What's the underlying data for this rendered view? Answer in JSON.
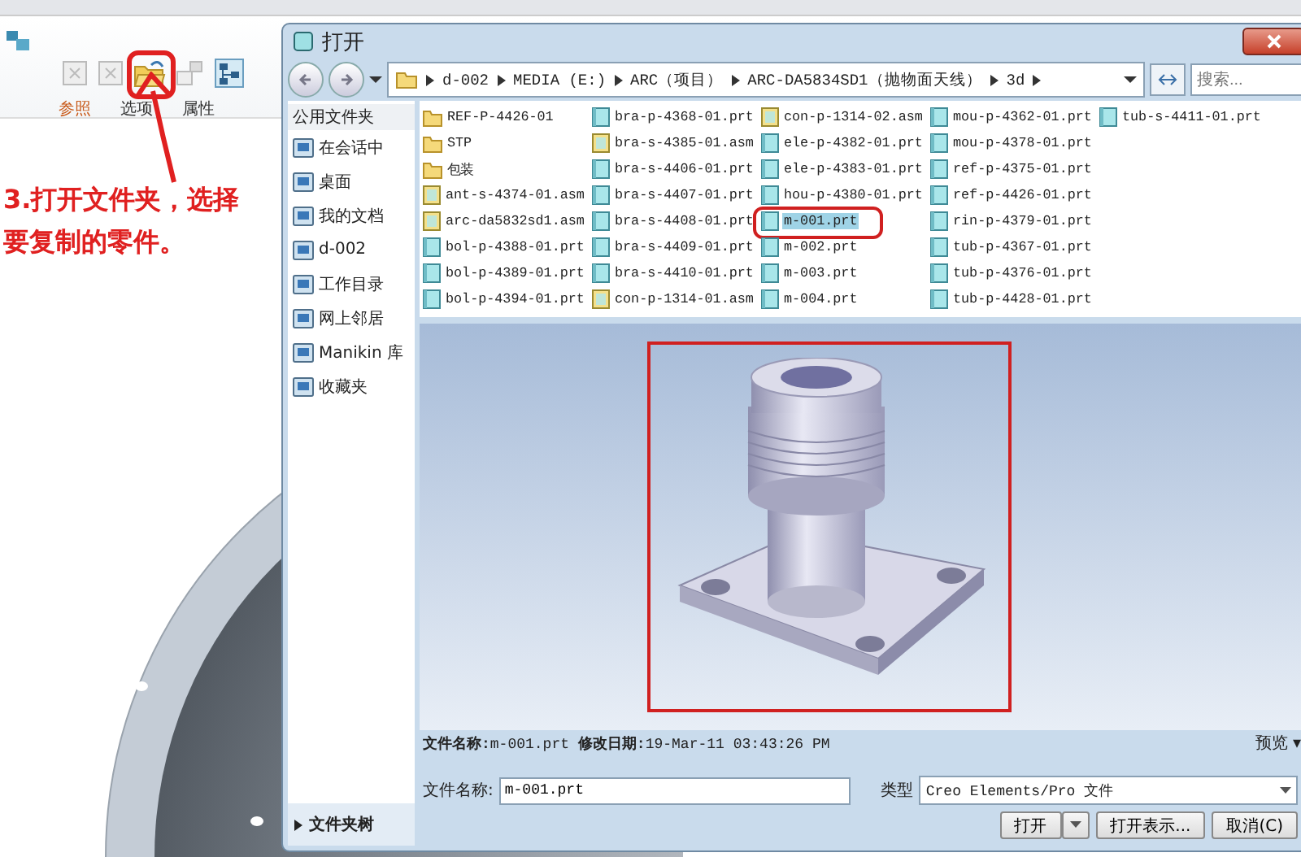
{
  "toolbar": {
    "tabs": [
      {
        "label": "参照",
        "selected": true
      },
      {
        "label": "选项",
        "selected": false
      },
      {
        "label": "属性",
        "selected": false
      }
    ]
  },
  "annotation": {
    "text": "3.打开文件夹，选择要复制的零件。"
  },
  "dialog": {
    "title": "打开",
    "breadcrumb": [
      "d-002",
      "MEDIA (E:)",
      "ARC（项目）",
      "ARC-DA5834SD1（抛物面天线）",
      "3d"
    ],
    "search": {
      "placeholder": "搜索..."
    },
    "sidebar": {
      "header": "公用文件夹",
      "items": [
        "在会话中",
        "桌面",
        "我的文档",
        "d-002",
        "工作目录",
        "网上邻居",
        "Manikin 库",
        "收藏夹"
      ],
      "footer": "文件夹树"
    },
    "files": [
      {
        "name": "REF-P-4426-01",
        "kind": "folder",
        "selected": false,
        "annotated": false
      },
      {
        "name": "STP",
        "kind": "folder",
        "selected": false,
        "annotated": false
      },
      {
        "name": "包装",
        "kind": "folder",
        "selected": false,
        "annotated": false
      },
      {
        "name": "ant-s-4374-01.asm",
        "kind": "asm",
        "selected": false,
        "annotated": false
      },
      {
        "name": "arc-da5832sd1.asm",
        "kind": "asm",
        "selected": false,
        "annotated": false
      },
      {
        "name": "bol-p-4388-01.prt",
        "kind": "prt",
        "selected": false,
        "annotated": false
      },
      {
        "name": "bol-p-4389-01.prt",
        "kind": "prt",
        "selected": false,
        "annotated": false
      },
      {
        "name": "bol-p-4394-01.prt",
        "kind": "prt",
        "selected": false,
        "annotated": false
      },
      {
        "name": "bra-p-4368-01.prt",
        "kind": "prt",
        "selected": false,
        "annotated": false
      },
      {
        "name": "bra-s-4385-01.asm",
        "kind": "asm",
        "selected": false,
        "annotated": false
      },
      {
        "name": "bra-s-4406-01.prt",
        "kind": "prt",
        "selected": false,
        "annotated": false
      },
      {
        "name": "bra-s-4407-01.prt",
        "kind": "prt",
        "selected": false,
        "annotated": false
      },
      {
        "name": "bra-s-4408-01.prt",
        "kind": "prt",
        "selected": false,
        "annotated": false
      },
      {
        "name": "bra-s-4409-01.prt",
        "kind": "prt",
        "selected": false,
        "annotated": false
      },
      {
        "name": "bra-s-4410-01.prt",
        "kind": "prt",
        "selected": false,
        "annotated": false
      },
      {
        "name": "con-p-1314-01.asm",
        "kind": "asm",
        "selected": false,
        "annotated": false
      },
      {
        "name": "con-p-1314-02.asm",
        "kind": "asm",
        "selected": false,
        "annotated": false
      },
      {
        "name": "ele-p-4382-01.prt",
        "kind": "prt",
        "selected": false,
        "annotated": false
      },
      {
        "name": "ele-p-4383-01.prt",
        "kind": "prt",
        "selected": false,
        "annotated": false
      },
      {
        "name": "hou-p-4380-01.prt",
        "kind": "prt",
        "selected": false,
        "annotated": false
      },
      {
        "name": "m-001.prt",
        "kind": "prt",
        "selected": true,
        "annotated": true
      },
      {
        "name": "m-002.prt",
        "kind": "prt",
        "selected": false,
        "annotated": false
      },
      {
        "name": "m-003.prt",
        "kind": "prt",
        "selected": false,
        "annotated": false
      },
      {
        "name": "m-004.prt",
        "kind": "prt",
        "selected": false,
        "annotated": false
      },
      {
        "name": "mou-p-4362-01.prt",
        "kind": "prt",
        "selected": false,
        "annotated": false
      },
      {
        "name": "mou-p-4378-01.prt",
        "kind": "prt",
        "selected": false,
        "annotated": false
      },
      {
        "name": "ref-p-4375-01.prt",
        "kind": "prt",
        "selected": false,
        "annotated": false
      },
      {
        "name": "ref-p-4426-01.prt",
        "kind": "prt",
        "selected": false,
        "annotated": false
      },
      {
        "name": "rin-p-4379-01.prt",
        "kind": "prt",
        "selected": false,
        "annotated": false
      },
      {
        "name": "tub-p-4367-01.prt",
        "kind": "prt",
        "selected": false,
        "annotated": false
      },
      {
        "name": "tub-p-4376-01.prt",
        "kind": "prt",
        "selected": false,
        "annotated": false
      },
      {
        "name": "tub-p-4428-01.prt",
        "kind": "prt",
        "selected": false,
        "annotated": false
      },
      {
        "name": "tub-s-4411-01.prt",
        "kind": "prt",
        "selected": false,
        "annotated": false
      }
    ],
    "info": "**文件名称:**m-001.prt **修改日期:**19-Mar-11 03:43:26 PM",
    "preview_label": "预览 ▾",
    "filename": {
      "label": "文件名称:",
      "value": "m-001.prt"
    },
    "type": {
      "label": "类型",
      "value": "Creo Elements/Pro 文件"
    },
    "buttons": {
      "open": "打开",
      "open_rep": "打开表示...",
      "cancel": "取消(C)"
    }
  }
}
